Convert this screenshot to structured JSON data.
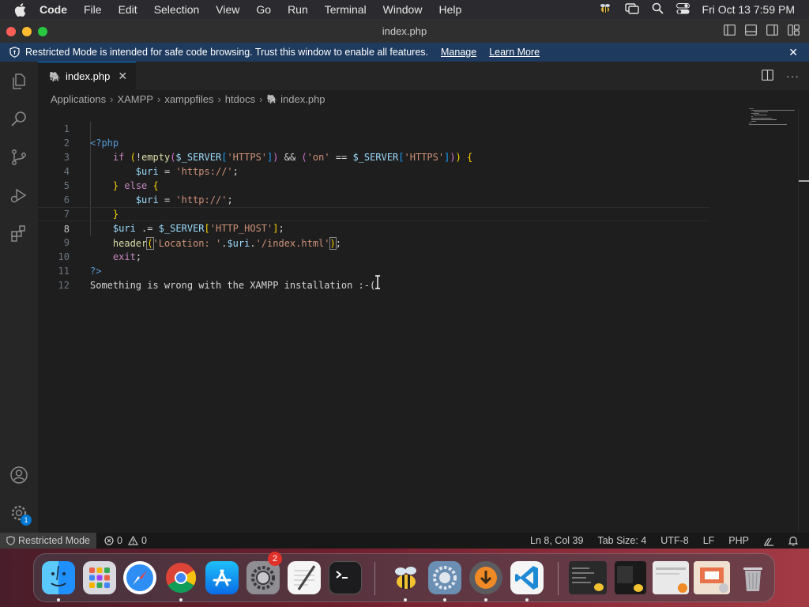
{
  "menubar": {
    "app_name": "Code",
    "items": [
      "File",
      "Edit",
      "Selection",
      "View",
      "Go",
      "Run",
      "Terminal",
      "Window",
      "Help"
    ],
    "datetime": "Fri Oct 13  7:59 PM"
  },
  "window": {
    "title": "index.php"
  },
  "notice": {
    "text": "Restricted Mode is intended for safe code browsing. Trust this window to enable all features.",
    "manage": "Manage",
    "learn_more": "Learn More"
  },
  "tab": {
    "label": "index.php"
  },
  "breadcrumb": [
    "Applications",
    "XAMPP",
    "xamppfiles",
    "htdocs",
    "index.php"
  ],
  "editor": {
    "line_numbers": [
      "1",
      "2",
      "3",
      "4",
      "5",
      "6",
      "7",
      "8",
      "9",
      "10",
      "11",
      "12"
    ],
    "current_line": 8,
    "tokens": {
      "php_open": "<?php",
      "if": "if",
      "empty_fn": "empty",
      "server": "$_SERVER",
      "https_key": "'HTTPS'",
      "and_op": "&&",
      "on_str": "'on'",
      "eq_op": "==",
      "uri": "$uri",
      "assign": "=",
      "https_str": "'https://'",
      "else": "else",
      "http_str": "'http://'",
      "concat_assign": ".=",
      "http_host_key": "'HTTP_HOST'",
      "header_fn": "header",
      "location_str": "'Location: '",
      "dot": ".",
      "index_str": "'/index.html'",
      "exit": "exit",
      "php_close": "?>",
      "message": "Something is wrong with the XAMPP installation :-("
    }
  },
  "status": {
    "restricted": "Restricted Mode",
    "errors": "0",
    "warnings": "0",
    "position": "Ln 8, Col 39",
    "tab_size": "Tab Size: 4",
    "encoding": "UTF-8",
    "eol": "LF",
    "language": "PHP"
  },
  "activity": {
    "settings_badge": "1"
  },
  "dock": {
    "settings_badge": "2"
  },
  "colors": {
    "accent": "#0078d4",
    "notice_bg": "#1e3a5f",
    "php_icon": "#a074c4"
  }
}
